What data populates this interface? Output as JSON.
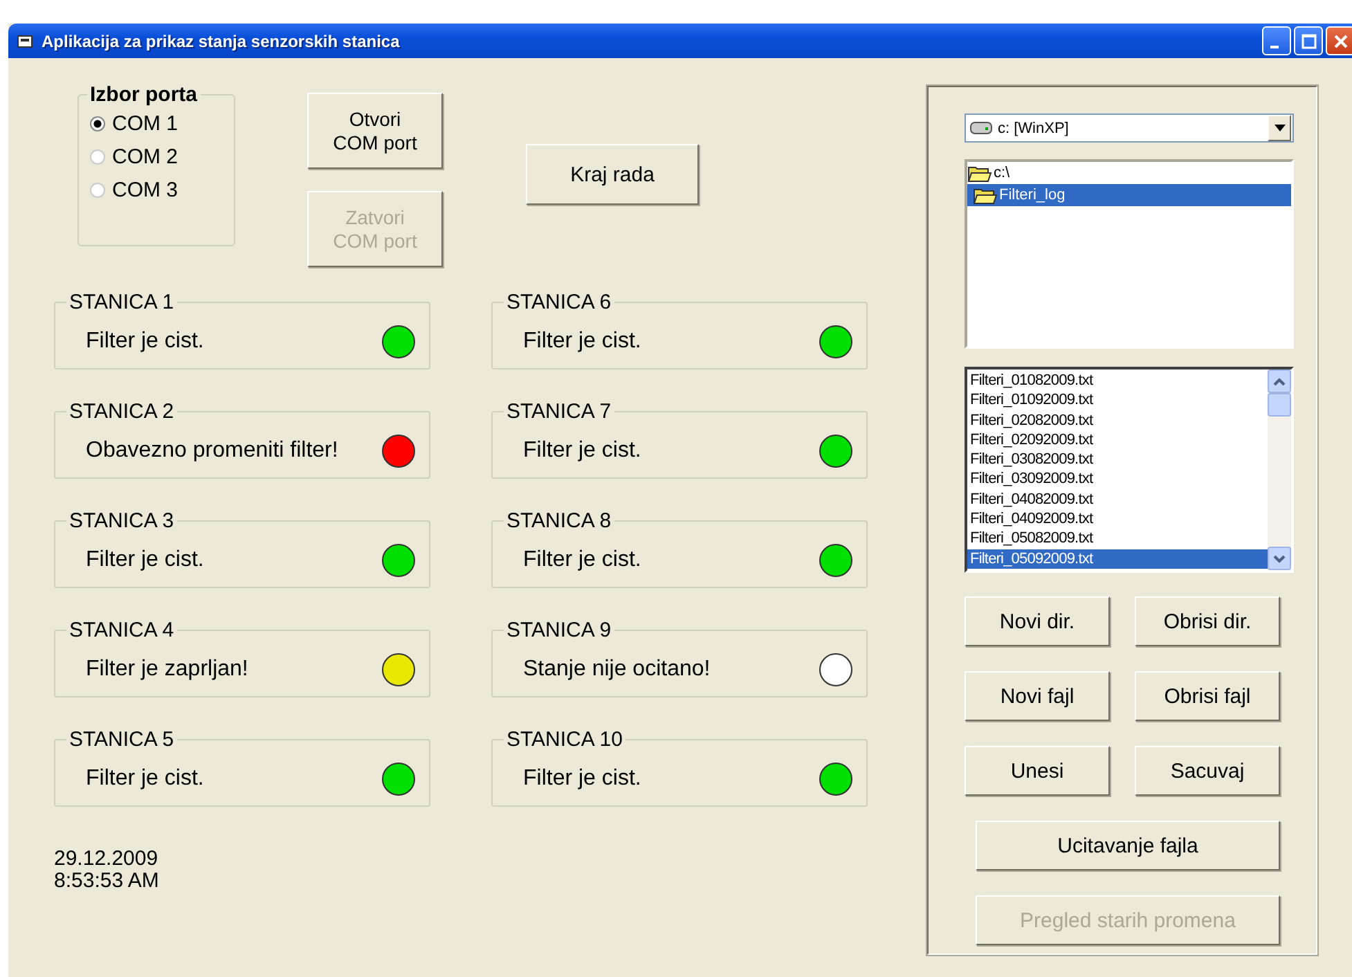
{
  "window": {
    "title": "Aplikacija za prikaz stanja senzorskih stanica"
  },
  "port_group": {
    "title": "Izbor porta",
    "options": [
      {
        "label": "COM 1",
        "selected": true
      },
      {
        "label": "COM 2",
        "selected": false
      },
      {
        "label": "COM 3",
        "selected": false
      }
    ]
  },
  "port_buttons": [
    {
      "label": "Otvori COM port",
      "disabled": false
    },
    {
      "label": "Zatvori COM port",
      "disabled": true
    }
  ],
  "exit_button": {
    "label": "Kraj rada"
  },
  "stations": [
    {
      "name": "STANICA 1",
      "status": "Filter je cist.",
      "color": "#00e000"
    },
    {
      "name": "STANICA 2",
      "status": "Obavezno promeniti filter!",
      "color": "#ff0000"
    },
    {
      "name": "STANICA 3",
      "status": "Filter je cist.",
      "color": "#00e000"
    },
    {
      "name": "STANICA 4",
      "status": "Filter je zaprljan!",
      "color": "#e8e800"
    },
    {
      "name": "STANICA 5",
      "status": "Filter je cist.",
      "color": "#00e000"
    },
    {
      "name": "STANICA 6",
      "status": "Filter je cist.",
      "color": "#00e000"
    },
    {
      "name": "STANICA 7",
      "status": "Filter je cist.",
      "color": "#00e000"
    },
    {
      "name": "STANICA 8",
      "status": "Filter je cist.",
      "color": "#00e000"
    },
    {
      "name": "STANICA 9",
      "status": "Stanje nije ocitano!",
      "color": "#ffffff"
    },
    {
      "name": "STANICA 10",
      "status": "Filter je cist.",
      "color": "#00e000"
    }
  ],
  "date": "29.12.2009",
  "time": "8:53:53 AM",
  "drive": "c: [WinXP]",
  "folders": [
    {
      "label": "c:\\",
      "selected": false
    },
    {
      "label": "Filteri_log",
      "selected": true
    }
  ],
  "files": [
    {
      "name": "Filteri_01082009.txt",
      "selected": false
    },
    {
      "name": "Filteri_01092009.txt",
      "selected": false
    },
    {
      "name": "Filteri_02082009.txt",
      "selected": false
    },
    {
      "name": "Filteri_02092009.txt",
      "selected": false
    },
    {
      "name": "Filteri_03082009.txt",
      "selected": false
    },
    {
      "name": "Filteri_03092009.txt",
      "selected": false
    },
    {
      "name": "Filteri_04082009.txt",
      "selected": false
    },
    {
      "name": "Filteri_04092009.txt",
      "selected": false
    },
    {
      "name": "Filteri_05082009.txt",
      "selected": false
    },
    {
      "name": "Filteri_05092009.txt",
      "selected": true
    }
  ],
  "file_buttons": [
    {
      "label": "Novi dir.",
      "disabled": false,
      "kind": "half"
    },
    {
      "label": "Obrisi dir.",
      "disabled": false,
      "kind": "half"
    },
    {
      "label": "Novi fajl",
      "disabled": false,
      "kind": "half"
    },
    {
      "label": "Obrisi fajl",
      "disabled": false,
      "kind": "half"
    },
    {
      "label": "Unesi",
      "disabled": false,
      "kind": "half"
    },
    {
      "label": "Sacuvaj",
      "disabled": false,
      "kind": "half"
    },
    {
      "label": "Ucitavanje fajla",
      "disabled": false,
      "kind": "wide"
    },
    {
      "label": "Pregled starih promena",
      "disabled": true,
      "kind": "wide"
    }
  ]
}
